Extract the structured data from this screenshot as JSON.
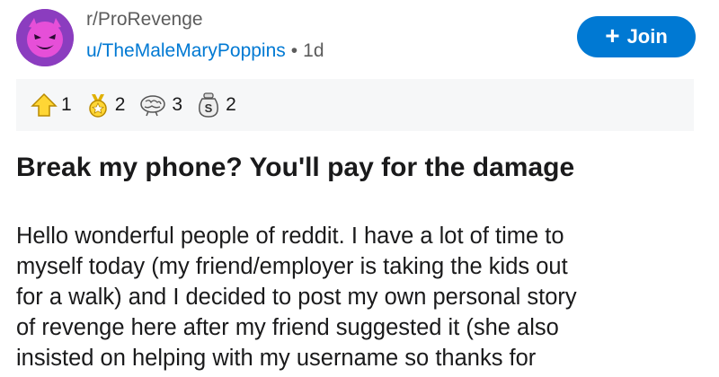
{
  "header": {
    "subreddit": "r/ProRevenge",
    "username": "u/TheMaleMaryPoppins",
    "separator": "•",
    "age": "1d",
    "avatar_icon": "devil-face-icon",
    "join_label": "Join",
    "join_color": "#0079d3"
  },
  "awards": [
    {
      "icon": "upvote-award-icon",
      "count": "1"
    },
    {
      "icon": "star-medal-award-icon",
      "count": "2"
    },
    {
      "icon": "brain-award-icon",
      "count": "3"
    },
    {
      "icon": "money-bag-award-icon",
      "count": "2"
    }
  ],
  "post": {
    "title": "Break my phone? You'll pay for the damage",
    "body_lines": [
      "Hello wonderful people of reddit. I have a lot of time to",
      "myself today (my friend/employer is taking the kids out",
      "for a walk) and I decided to post my own personal story",
      "of revenge here after my friend suggested it (she also",
      "insisted on helping with my username so thanks for"
    ]
  }
}
